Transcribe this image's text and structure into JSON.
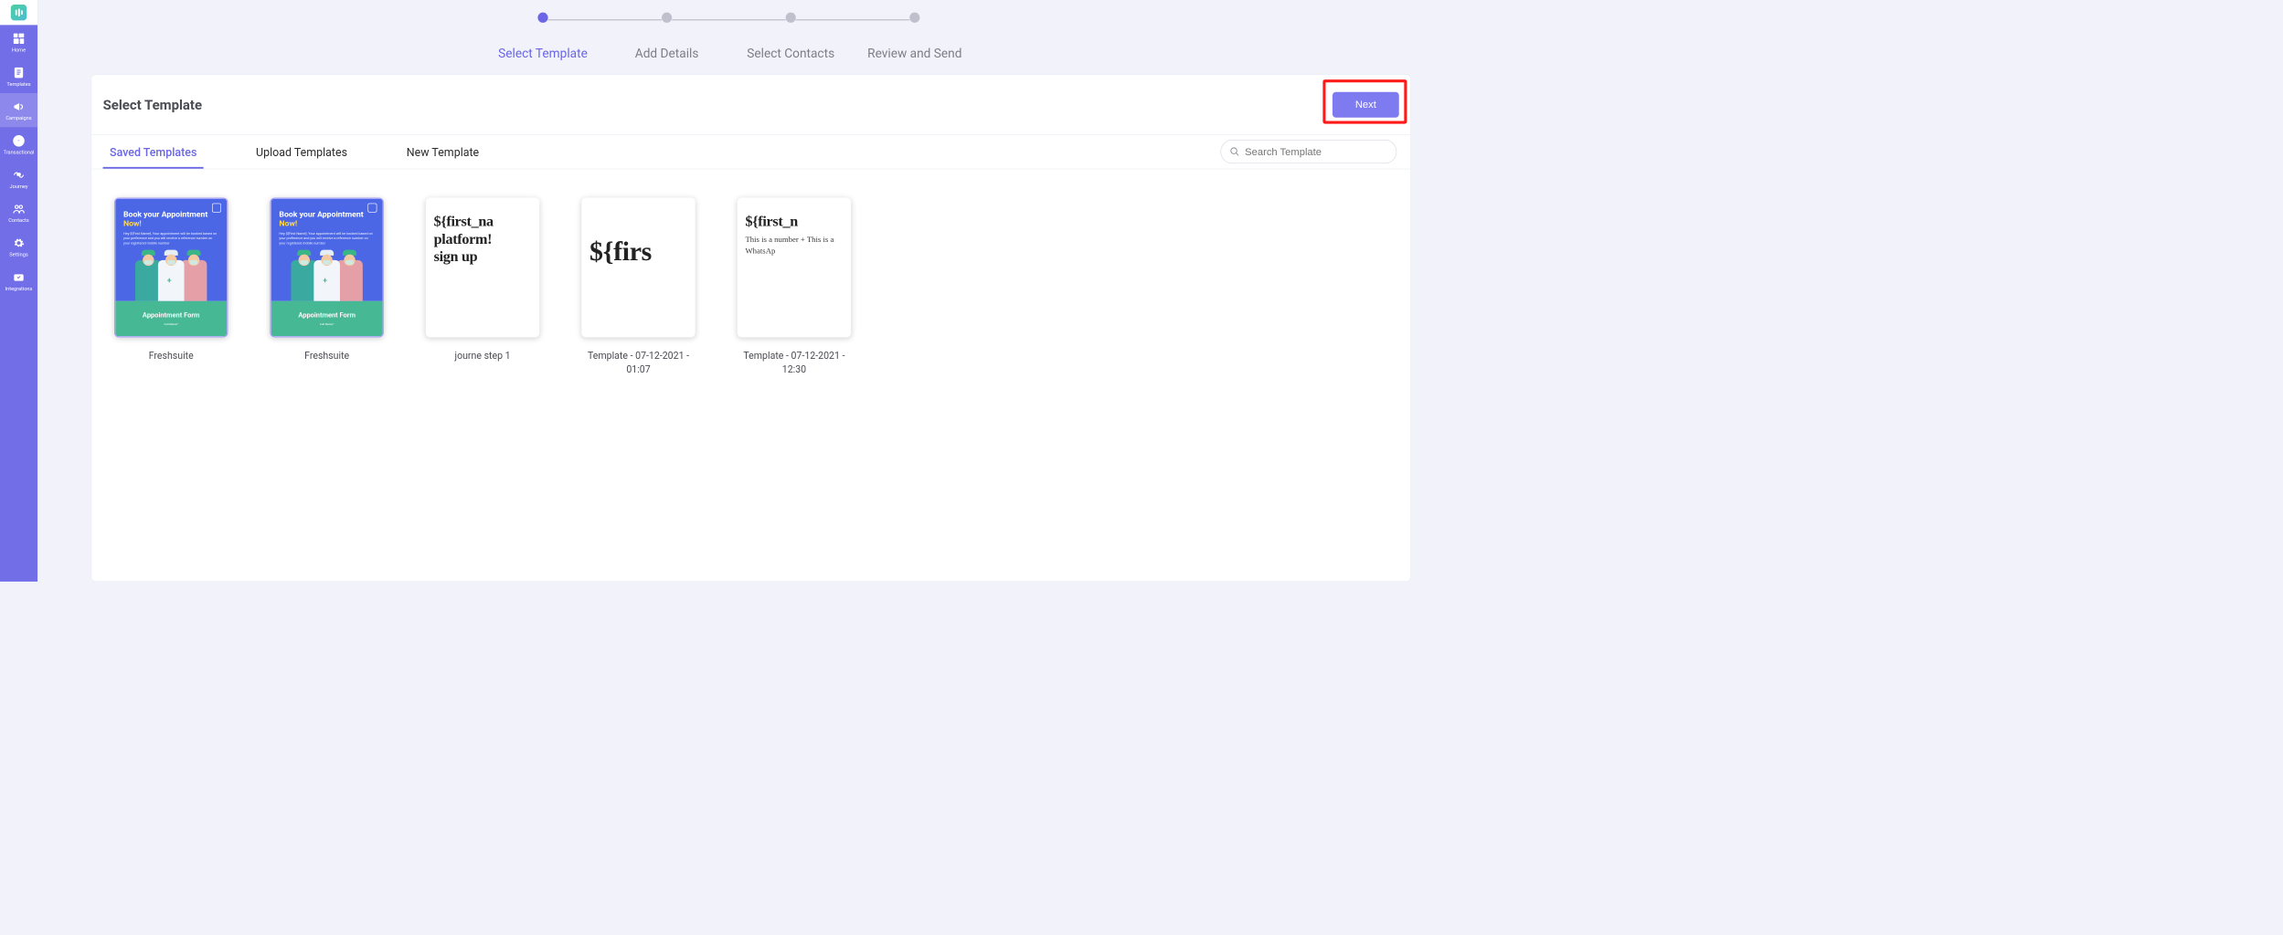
{
  "sidebar": {
    "items": [
      {
        "label": "Home"
      },
      {
        "label": "Templates"
      },
      {
        "label": "Campaigns"
      },
      {
        "label": "Transactional"
      },
      {
        "label": "Journey"
      },
      {
        "label": "Contacts"
      },
      {
        "label": "Settings"
      },
      {
        "label": "Integrations"
      }
    ]
  },
  "stepper": {
    "steps": [
      {
        "label": "Select Template",
        "active": true
      },
      {
        "label": "Add Details",
        "active": false
      },
      {
        "label": "Select Contacts",
        "active": false
      },
      {
        "label": "Review and Send",
        "active": false
      }
    ]
  },
  "card": {
    "title": "Select Template",
    "next_label": "Next"
  },
  "tabs": [
    {
      "label": "Saved Templates",
      "active": true
    },
    {
      "label": "Upload Templates",
      "active": false
    },
    {
      "label": "New Template",
      "active": false
    }
  ],
  "search": {
    "placeholder": "Search Template",
    "value": ""
  },
  "templates": [
    {
      "name": "Freshsuite",
      "kind": "appointment",
      "apt": {
        "heading": "Book your Appointment",
        "accent": "Now!",
        "desc": "Hey ${First Name}, Your appointment will be booked based on your preference and you will receive a reference number on your registered mobile number",
        "form_title": "Appointment Form",
        "field": "Full Name*"
      }
    },
    {
      "name": "Freshsuite",
      "kind": "appointment",
      "apt": {
        "heading": "Book your Appointment",
        "accent": "Now!",
        "desc": "Hey ${First Name}, Your appointment will be booked based on your preference and you will receive a reference number on your registered mobile number",
        "form_title": "Appointment Form",
        "field": "Full Name*"
      }
    },
    {
      "name": "journe step 1",
      "kind": "text",
      "big": "${first_na\nplatform!\nsign up"
    },
    {
      "name": "Template - 07-12-2021 - 01:07",
      "kind": "text",
      "huge": "${firs"
    },
    {
      "name": "Template - 07-12-2021 - 12:30",
      "kind": "text",
      "big": "${first_n",
      "body": "This is a number +\nThis is a WhatsAp"
    }
  ]
}
